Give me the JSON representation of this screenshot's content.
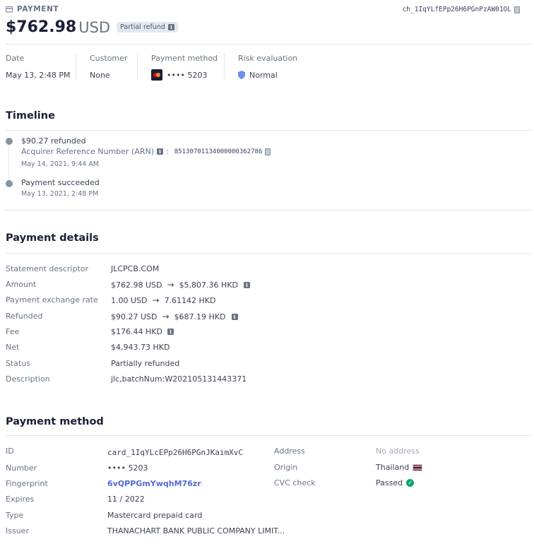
{
  "header": {
    "label": "PAYMENT",
    "charge_id": "ch_1IqYLfEPp26H6PGnPzAW01OL",
    "amount": "$762.98",
    "currency": "USD",
    "badge": "Partial refund"
  },
  "summary": [
    {
      "label": "Date",
      "value": "May 13, 2:48 PM"
    },
    {
      "label": "Customer",
      "value": "None"
    },
    {
      "label": "Payment method",
      "value": "•••• 5203",
      "icon": "mastercard-icon"
    },
    {
      "label": "Risk evaluation",
      "value": "Normal",
      "icon": "shield-icon"
    }
  ],
  "timeline": {
    "title": "Timeline",
    "events": [
      {
        "title": "$90.27 refunded",
        "sub_label": "Acquirer Reference Number (ARN)",
        "sub_value": "85130701134000000362786",
        "time": "May 14, 2021, 9:44 AM"
      },
      {
        "title": "Payment succeeded",
        "time": "May 13, 2021, 2:48 PM"
      }
    ]
  },
  "payment_details": {
    "title": "Payment details",
    "rows": [
      {
        "label": "Statement descriptor",
        "value": "JLCPCB.COM"
      },
      {
        "label": "Amount",
        "value": "$762.98 USD",
        "converted": "$5,807.36 HKD",
        "info": true
      },
      {
        "label": "Payment exchange rate",
        "value": "1.00 USD",
        "converted": "7.61142 HKD"
      },
      {
        "label": "Refunded",
        "value": "$90.27 USD",
        "converted": "$687.19 HKD",
        "info": true
      },
      {
        "label": "Fee",
        "value": "$176.44 HKD",
        "info": true
      },
      {
        "label": "Net",
        "value": "$4,943.73 HKD"
      },
      {
        "label": "Status",
        "value": "Partially refunded"
      },
      {
        "label": "Description",
        "value": "jlc,batchNum:W202105131443371"
      }
    ]
  },
  "payment_method": {
    "title": "Payment method",
    "left": [
      {
        "label": "ID",
        "value": "card_1IqYLcEPp26H6PGnJKaimXvC"
      },
      {
        "label": "Number",
        "value": "•••• 5203"
      },
      {
        "label": "Fingerprint",
        "value": "6vQPPGmYwqhM76zr"
      },
      {
        "label": "Expires",
        "value": "11 / 2022"
      },
      {
        "label": "Type",
        "value": "Mastercard prepaid card"
      },
      {
        "label": "Issuer",
        "value": "THANACHART BANK PUBLIC COMPANY LIMIT..."
      }
    ],
    "right": [
      {
        "label": "Address",
        "value": "No address"
      },
      {
        "label": "Origin",
        "value": "Thailand"
      },
      {
        "label": "CVC check",
        "value": "Passed"
      }
    ]
  },
  "colors": {
    "accent": "#5469d4",
    "success": "#09a66d",
    "text": "#3c4257",
    "muted": "#697386"
  }
}
